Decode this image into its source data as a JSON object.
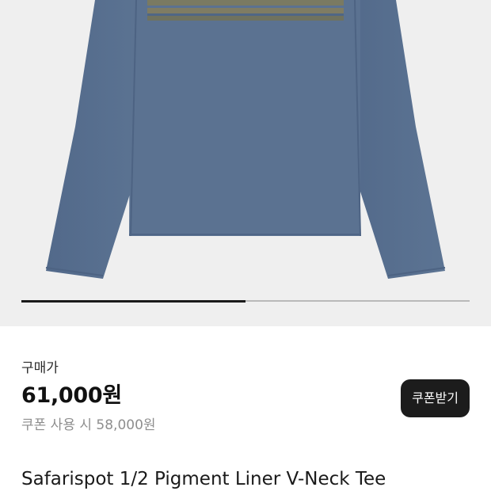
{
  "gallery": {
    "image_progress": 0.5
  },
  "pricing": {
    "label": "구매가",
    "price": "61,000원",
    "coupon_price_text": "쿠폰 사용 시 58,000원"
  },
  "coupon_button": {
    "label": "쿠폰받기"
  },
  "product": {
    "title": "Safarispot 1/2 Pigment Liner V-Neck Tee"
  },
  "colors": {
    "garment_blue": "#5a7190",
    "stripe_olive": "#7d7b62",
    "background_gray": "#efefef",
    "button_dark": "#1c1c1c"
  }
}
